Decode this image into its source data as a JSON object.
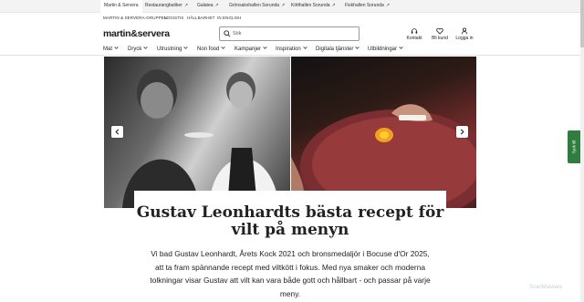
{
  "utility_bar": {
    "items": [
      {
        "label": "Martin & Servera",
        "external": false
      },
      {
        "label": "Restaurangbutiker",
        "external": true
      },
      {
        "label": "Galatea",
        "external": true
      },
      {
        "label": "Grönsakshallen Sorunda",
        "external": true
      },
      {
        "label": "Kötthallen Sorunda",
        "external": true
      },
      {
        "label": "Fiskhallen Sorunda",
        "external": true
      }
    ]
  },
  "secondary_links": [
    "MARTIN & SERVERA-GRUPPEN",
    "LOGISTIK",
    "HÅLLBARHET",
    "IN ENGLISH"
  ],
  "header": {
    "logo": "martin&servera",
    "search_placeholder": "Sök",
    "actions": [
      {
        "label": "Kontakt",
        "icon": "headset-icon"
      },
      {
        "label": "Bli kund",
        "icon": "heart-icon"
      },
      {
        "label": "Logga in",
        "icon": "user-icon"
      }
    ]
  },
  "nav": {
    "items": [
      "Mat",
      "Dryck",
      "Utrustning",
      "Non food",
      "Kampanjer",
      "Inspiration",
      "Digitala tjänster",
      "Utbildningar"
    ]
  },
  "article": {
    "title": "Gustav Leonhardts bästa recept för vilt på menyn",
    "lede": "Vi bad Gustav Leonhardt, Årets Kock 2021 och bronsmedaljör i Bocuse d'Or 2025, att ta fram spännande recept med viltkött i fokus. Med nya smaker och moderna tolkningar visar Gustav att vilt kan vara både gott och hållbart - och passar på varje meny."
  },
  "side_tab": {
    "label": "Tyck till"
  },
  "watermark": "ScanMalware",
  "colors": {
    "accent_green": "#2f7d3f"
  }
}
